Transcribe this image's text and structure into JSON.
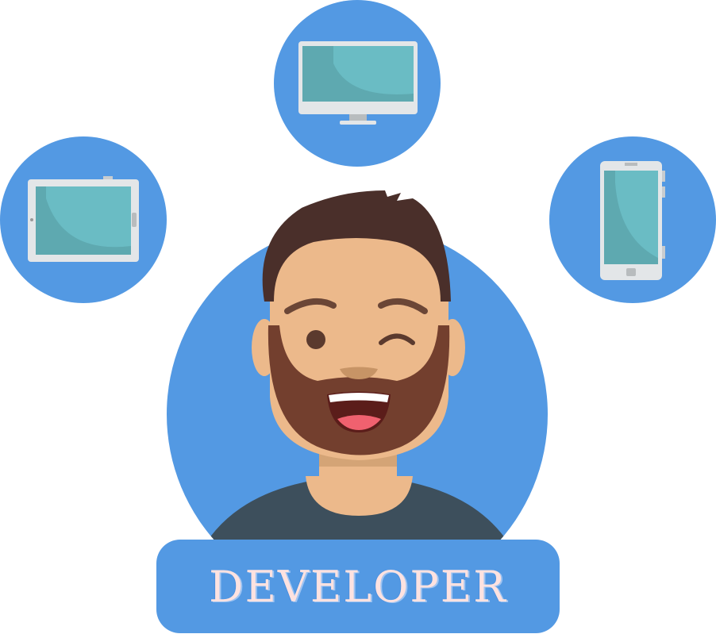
{
  "banner": {
    "label": "DEVELOPER"
  },
  "colors": {
    "blue": "#5399e3",
    "skin": "#ecb98b",
    "hair": "#4a2f2a",
    "beard": "#733f2e",
    "shirt": "#3d4f5c",
    "screen": "#66b9c2"
  },
  "icons": [
    "desktop-monitor-icon",
    "tablet-icon",
    "smartphone-icon"
  ]
}
